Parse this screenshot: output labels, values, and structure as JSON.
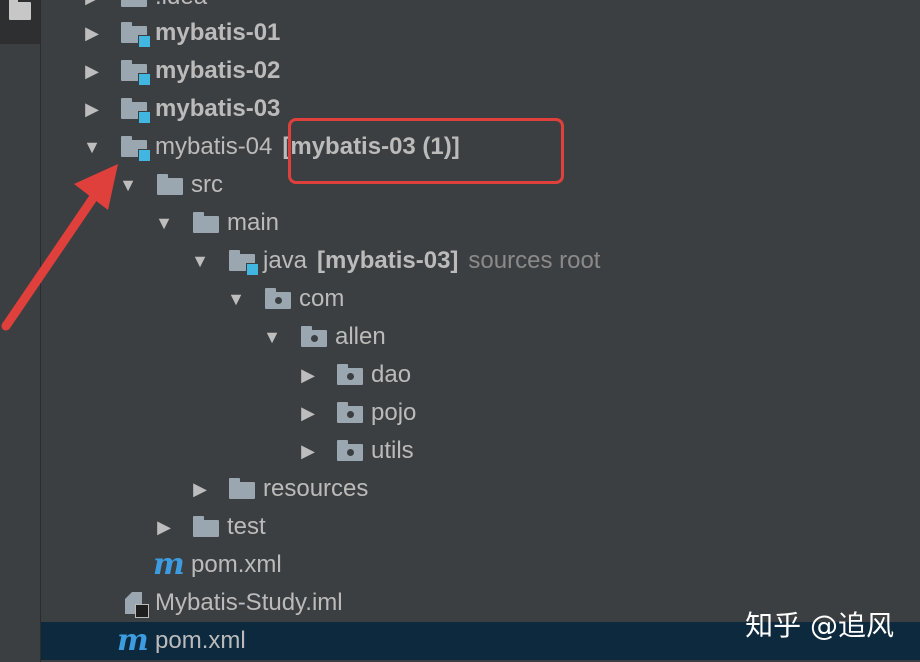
{
  "tree": {
    "partial_top": ".idea",
    "items": [
      {
        "label": "mybatis-01"
      },
      {
        "label": "mybatis-02"
      },
      {
        "label": "mybatis-03"
      },
      {
        "label": "mybatis-04",
        "suffix": "[mybatis-03 (1)]"
      },
      {
        "label": "src"
      },
      {
        "label": "main"
      },
      {
        "label": "java",
        "suffix": "[mybatis-03]",
        "hint": "sources root"
      },
      {
        "label": "com"
      },
      {
        "label": "allen"
      },
      {
        "label": "dao"
      },
      {
        "label": "pojo"
      },
      {
        "label": "utils"
      },
      {
        "label": "resources"
      },
      {
        "label": "test"
      },
      {
        "label": "pom.xml",
        "icon_text": "m"
      },
      {
        "label": "Mybatis-Study.iml"
      },
      {
        "label": "pom.xml",
        "icon_text": "m"
      }
    ]
  },
  "icons": {
    "expanded": "▼",
    "collapsed": "▶",
    "maven_icon": "m"
  },
  "colors": {
    "panel_bg": "#3c3f41",
    "selection_bg": "#0d293e",
    "module_badge": "#40b6e0",
    "annotation_red": "#e0403c",
    "maven_blue": "#3d9ce0"
  },
  "watermark": "知乎 @追风"
}
